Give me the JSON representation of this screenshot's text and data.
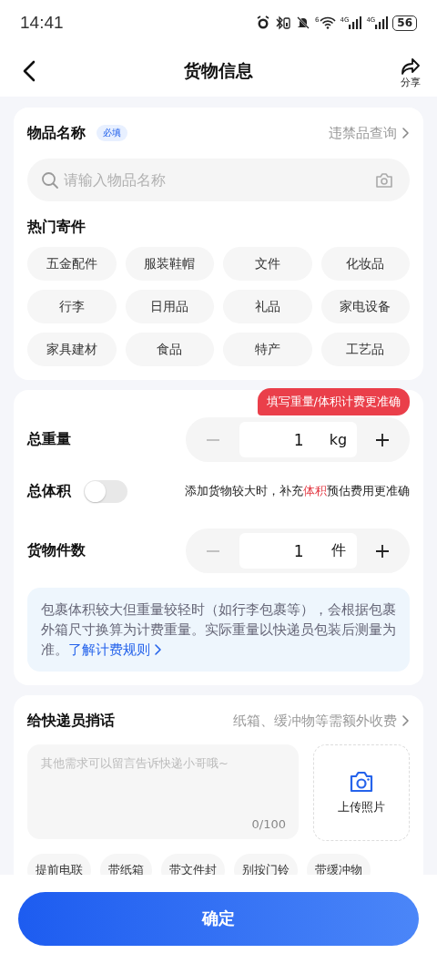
{
  "status_bar": {
    "time": "14:41",
    "wifi_label": "6",
    "networks": [
      "4G",
      "4G"
    ],
    "battery": "56"
  },
  "header": {
    "title": "货物信息",
    "share_label": "分享"
  },
  "item_card": {
    "title": "物品名称",
    "required_badge": "必填",
    "link": "违禁品查询",
    "search": {
      "placeholder": "请输入物品名称"
    },
    "popular_title": "热门寄件",
    "popular_items": [
      "五金配件",
      "服装鞋帽",
      "文件",
      "化妆品",
      "行李",
      "日用品",
      "礼品",
      "家电设备",
      "家具建材",
      "食品",
      "特产",
      "工艺品"
    ]
  },
  "measure_card": {
    "promo_badge": "填写重量/体积计费更准确",
    "rows": [
      {
        "kind": "stepper",
        "label": "总重量",
        "value": "1",
        "unit": "kg"
      },
      {
        "kind": "toggle",
        "label": "总体积",
        "on": false,
        "hint": "添加货物较大时，补充**体积**预估费用更准确"
      },
      {
        "kind": "stepper",
        "label": "货物件数",
        "value": "1",
        "unit": "件"
      }
    ],
    "note": {
      "text": "包裹体积较大但重量较轻时（如行李包裹等），会根据包裹外箱尺寸换算为计费重量。实际重量以快递员包装后测量为准。",
      "link": "了解计费规则"
    }
  },
  "message_card": {
    "title": "给快递员捎话",
    "link": "纸箱、缓冲物等需额外收费",
    "message": {
      "placeholder": "其他需求可以留言告诉快递小哥哦~",
      "counter": "0/100"
    },
    "upload_label": "上传照片",
    "quick_tags": [
      "提前电联",
      "带纸箱",
      "带文件封",
      "别按门铃",
      "带缓冲物"
    ]
  },
  "confirm_button": "确定"
}
